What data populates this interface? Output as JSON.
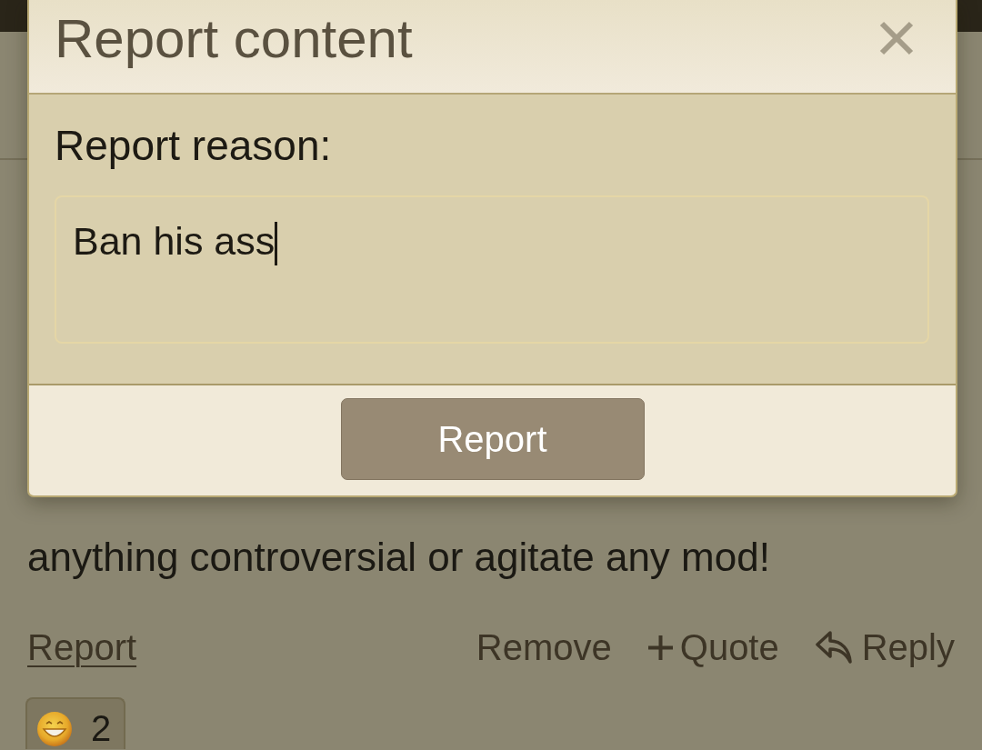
{
  "dialog": {
    "title": "Report content",
    "field_label": "Report reason:",
    "field": {
      "value": "Ban his ass",
      "focused": true
    },
    "submit_button": "Report"
  },
  "post": {
    "text": "anything controversial or agitate any mod!",
    "actions": [
      {
        "kind": "underlined",
        "label": "Report"
      },
      {
        "kind": "plain",
        "label": "Remove"
      },
      {
        "kind": "plus",
        "label": "Quote"
      },
      {
        "kind": "reply",
        "label": "Reply"
      }
    ],
    "reactions": [
      {
        "count": "2"
      }
    ]
  }
}
